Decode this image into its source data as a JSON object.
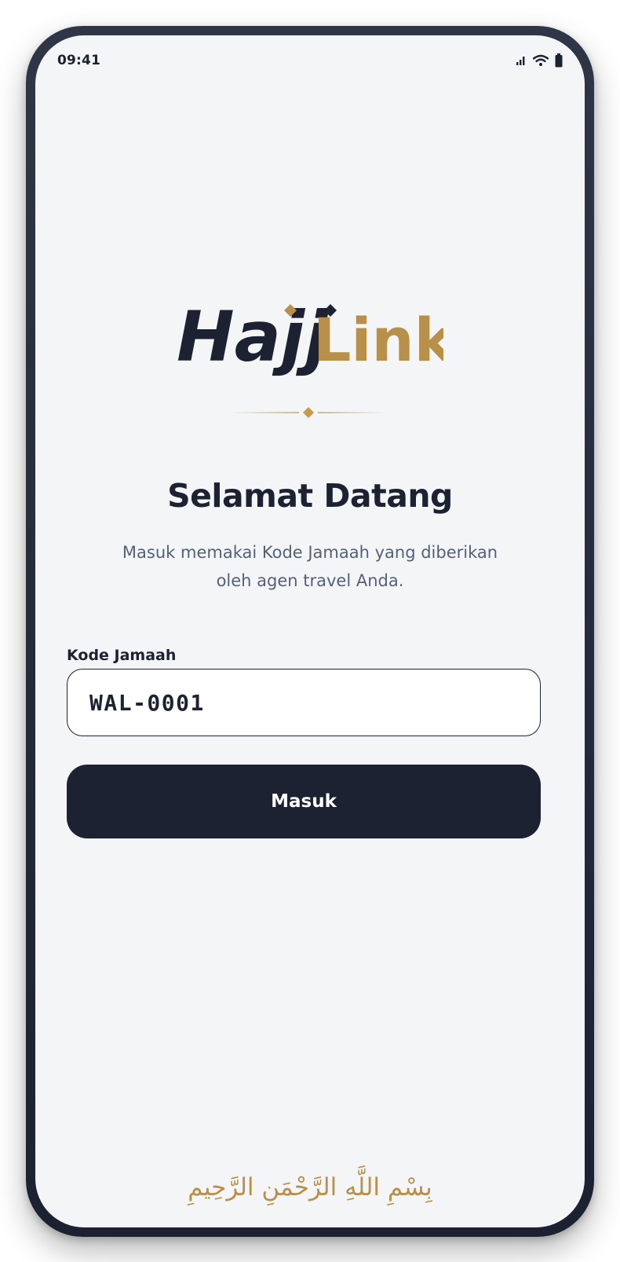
{
  "status_bar": {
    "time": "09:41",
    "icons": [
      "cellular-signal-icon",
      "wifi-icon",
      "battery-icon"
    ]
  },
  "brand": {
    "name_part1": "Hajj",
    "name_part2": "Link",
    "colors": {
      "dark": "#1c2231",
      "gold": "#b8904a"
    }
  },
  "welcome": {
    "title": "Selamat Datang",
    "subtitle": "Masuk memakai Kode Jamaah yang diberikan oleh agen travel Anda."
  },
  "form": {
    "code_label": "Kode Jamaah",
    "code_value": "WAL-0001",
    "submit_label": "Masuk"
  },
  "footer": {
    "basmala": "بِسْمِ اللَّهِ الرَّحْمَنِ الرَّحِيمِ"
  }
}
